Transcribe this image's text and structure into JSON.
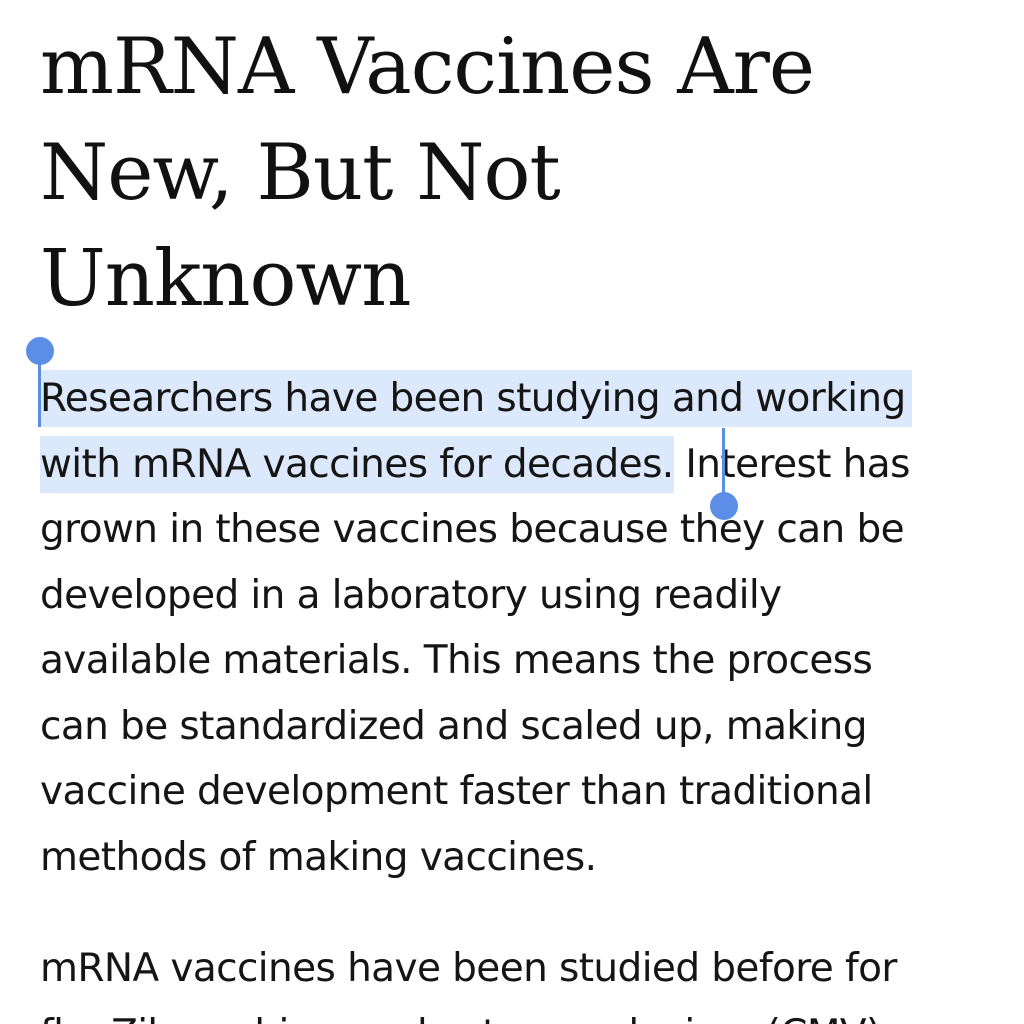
{
  "article": {
    "headline": {
      "lines": [
        "mRNA Vaccines Are",
        "New, But Not",
        "Unknown"
      ]
    },
    "paragraph1": {
      "selected_line1": "Researchers have been studying and working",
      "selected_line2": "with mRNA vaccines for decades.",
      "line2_rest": " Interest has",
      "lines_rest": [
        "grown in these vaccines because they can be",
        "developed in a laboratory using readily",
        "available materials. This means the process",
        "can be standardized and scaled up, making",
        "vaccine development faster than traditional",
        "methods of making vaccines."
      ]
    },
    "paragraph2": {
      "lines": [
        "mRNA vaccines have been studied before for",
        "flu, Zika, rabies, and cytomegalovirus (CMV)."
      ]
    }
  },
  "selection": {
    "highlight_color": "#dce8fb",
    "handle_color": "#5b8fe6"
  }
}
